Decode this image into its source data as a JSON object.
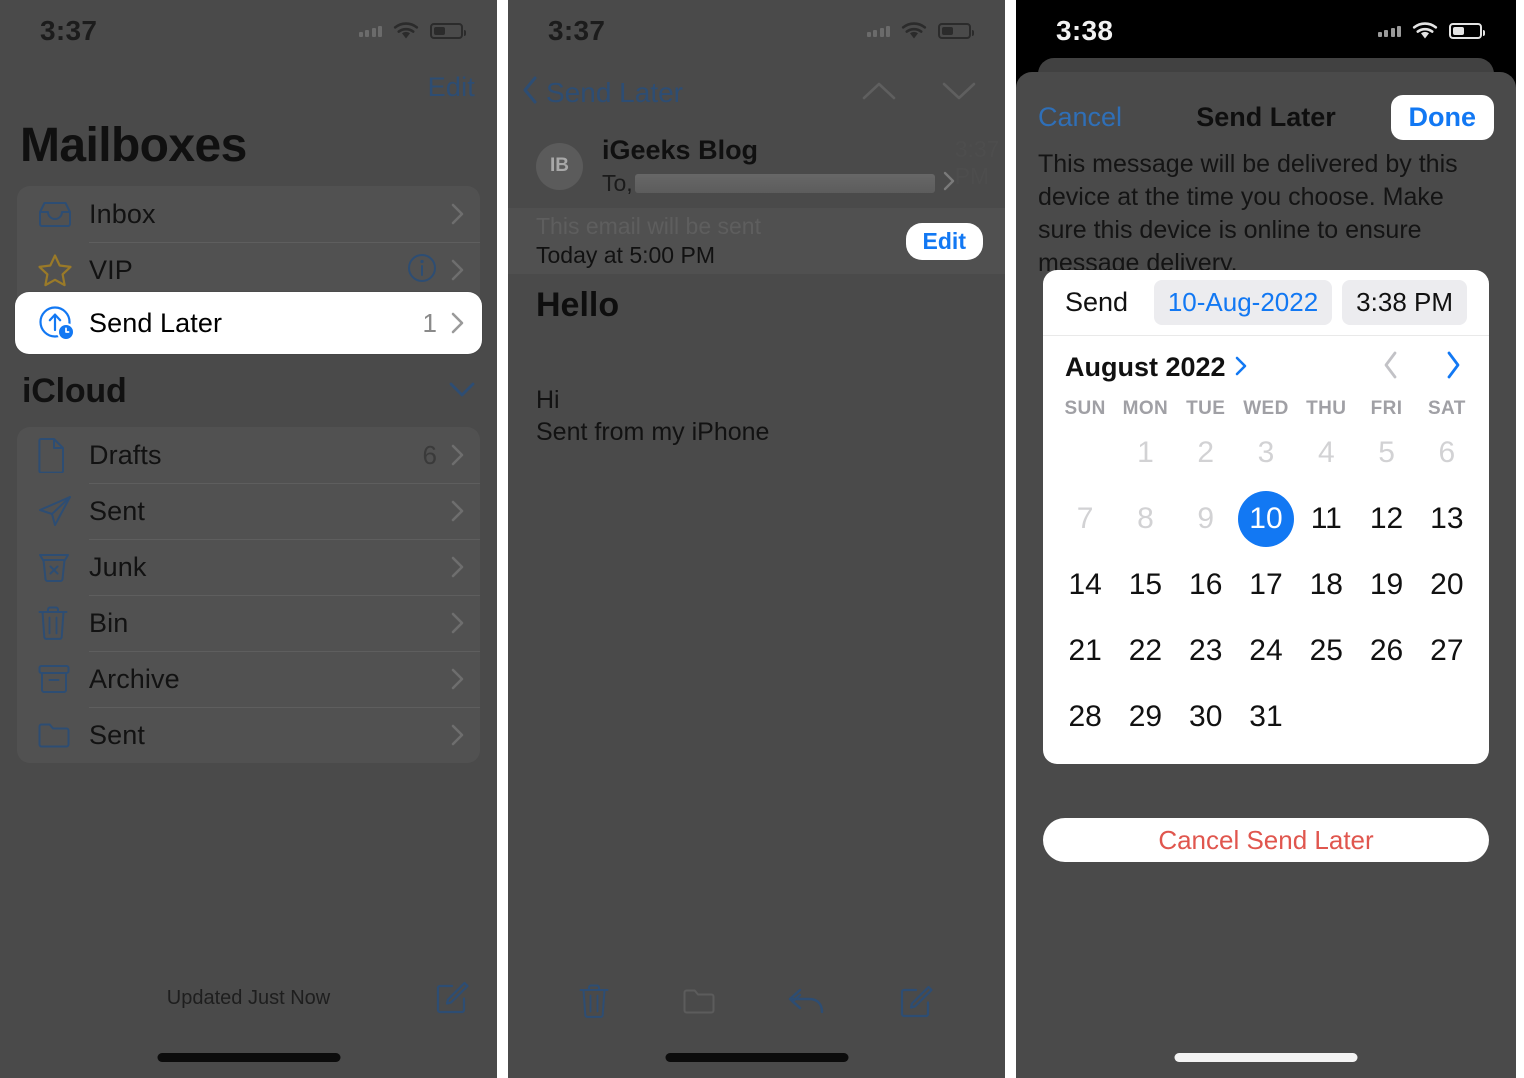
{
  "panel1": {
    "status": {
      "time": "3:37"
    },
    "edit_label": "Edit",
    "title": "Mailboxes",
    "top_group": [
      {
        "label": "Inbox",
        "icon": "inbox-icon",
        "count": ""
      },
      {
        "label": "VIP",
        "icon": "star-icon",
        "count": ""
      }
    ],
    "highlighted_row": {
      "label": "Send Later",
      "icon": "send-later-icon",
      "count": "1"
    },
    "section": {
      "title": "iCloud",
      "collapse_icon": "chevron-down-icon"
    },
    "icloud_group": [
      {
        "label": "Drafts",
        "icon": "document-icon",
        "count": "6"
      },
      {
        "label": "Sent",
        "icon": "paper-plane-icon",
        "count": ""
      },
      {
        "label": "Junk",
        "icon": "junk-bin-icon",
        "count": ""
      },
      {
        "label": "Bin",
        "icon": "trash-icon",
        "count": ""
      },
      {
        "label": "Archive",
        "icon": "archive-box-icon",
        "count": ""
      },
      {
        "label": "Sent",
        "icon": "folder-icon",
        "count": ""
      }
    ],
    "footer_status": "Updated Just Now",
    "compose_icon": "compose-icon"
  },
  "panel2": {
    "status": {
      "time": "3:37"
    },
    "back_label": "Send Later",
    "nav_up_icon": "chevron-up-icon",
    "nav_down_icon": "chevron-down-icon",
    "message": {
      "avatar_initials": "IB",
      "sender": "iGeeks Blog",
      "time": "3:37 PM",
      "to_label": "To,",
      "to_value_redacted": "",
      "subject": "Hello",
      "body_line1": "Hi",
      "body_line2": "Sent from my iPhone"
    },
    "send_info": {
      "line1": "This email will be sent",
      "line2": "Today at 5:00 PM",
      "edit_label": "Edit"
    },
    "toolbar": [
      {
        "name": "trash-icon",
        "disabled": false
      },
      {
        "name": "folder-icon",
        "disabled": true
      },
      {
        "name": "reply-icon",
        "disabled": false
      },
      {
        "name": "compose-icon",
        "disabled": false
      }
    ]
  },
  "panel3": {
    "status": {
      "time": "3:38"
    },
    "cancel_label": "Cancel",
    "title": "Send Later",
    "done_label": "Done",
    "description": "This message will be delivered by this device at the time you choose. Make sure this device is online to ensure message delivery.",
    "picker": {
      "send_label": "Send",
      "date_value": "10-Aug-2022",
      "time_value": "3:38 PM",
      "month_label": "August 2022",
      "month_expand_icon": "chevron-right-icon",
      "prev_icon": "chevron-left-icon",
      "next_icon": "chevron-right-icon",
      "weekdays": [
        "SUN",
        "MON",
        "TUE",
        "WED",
        "THU",
        "FRI",
        "SAT"
      ],
      "weeks": [
        [
          {
            "d": "",
            "state": "empty"
          },
          {
            "d": "1",
            "state": "dim"
          },
          {
            "d": "2",
            "state": "dim"
          },
          {
            "d": "3",
            "state": "dim"
          },
          {
            "d": "4",
            "state": "dim"
          },
          {
            "d": "5",
            "state": "dim"
          },
          {
            "d": "6",
            "state": "dim"
          }
        ],
        [
          {
            "d": "7",
            "state": "dim"
          },
          {
            "d": "8",
            "state": "dim"
          },
          {
            "d": "9",
            "state": "dim"
          },
          {
            "d": "10",
            "state": "sel"
          },
          {
            "d": "11",
            "state": ""
          },
          {
            "d": "12",
            "state": ""
          },
          {
            "d": "13",
            "state": ""
          }
        ],
        [
          {
            "d": "14",
            "state": ""
          },
          {
            "d": "15",
            "state": ""
          },
          {
            "d": "16",
            "state": ""
          },
          {
            "d": "17",
            "state": ""
          },
          {
            "d": "18",
            "state": ""
          },
          {
            "d": "19",
            "state": ""
          },
          {
            "d": "20",
            "state": ""
          }
        ],
        [
          {
            "d": "21",
            "state": ""
          },
          {
            "d": "22",
            "state": ""
          },
          {
            "d": "23",
            "state": ""
          },
          {
            "d": "24",
            "state": ""
          },
          {
            "d": "25",
            "state": ""
          },
          {
            "d": "26",
            "state": ""
          },
          {
            "d": "27",
            "state": ""
          }
        ],
        [
          {
            "d": "28",
            "state": ""
          },
          {
            "d": "29",
            "state": ""
          },
          {
            "d": "30",
            "state": ""
          },
          {
            "d": "31",
            "state": ""
          },
          {
            "d": "",
            "state": "empty"
          },
          {
            "d": "",
            "state": "empty"
          },
          {
            "d": "",
            "state": "empty"
          }
        ]
      ]
    },
    "cancel_send_later_label": "Cancel Send Later"
  },
  "colors": {
    "accent_blue": "#1278f3",
    "link_blue": "#2d4d73",
    "destructive_red": "#e0564e",
    "dim_background": "#4a4a4a",
    "sheet_background": "#4a4a4a",
    "card_white": "#ffffff"
  }
}
